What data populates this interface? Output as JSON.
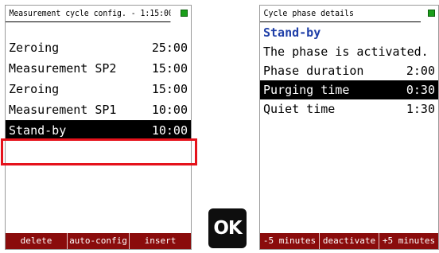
{
  "left_screen": {
    "title": "Measurement cycle config. - 1:15:00",
    "rows": [
      {
        "label": "Zeroing",
        "value": "25:00"
      },
      {
        "label": "Measurement SP2",
        "value": "15:00"
      },
      {
        "label": "Zeroing",
        "value": "15:00"
      },
      {
        "label": "Measurement SP1",
        "value": "10:00"
      },
      {
        "label": "Stand-by",
        "value": "10:00"
      }
    ],
    "softkeys": [
      "delete",
      "auto-config",
      "insert"
    ]
  },
  "ok_key": {
    "label": "OK"
  },
  "right_screen": {
    "title": "Cycle phase details",
    "phase_name": "Stand-by",
    "status": "The phase is activated.",
    "rows": [
      {
        "label": "Phase duration",
        "value": "2:00"
      },
      {
        "label": "Purging time",
        "value": "0:30"
      },
      {
        "label": "Quiet time",
        "value": "1:30"
      }
    ],
    "softkeys": [
      "-5 minutes",
      "deactivate",
      "+5 minutes"
    ]
  },
  "colors": {
    "softkey_bar": "#8a0c0c",
    "highlight_frame": "#e5121b",
    "phase_title": "#1f3fa8",
    "battery": "#1a9e1a"
  },
  "icons": [
    "battery-icon"
  ]
}
